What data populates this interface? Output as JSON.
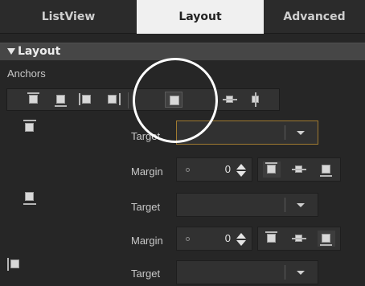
{
  "tabs": [
    {
      "label": "ListView",
      "active": false
    },
    {
      "label": "Layout",
      "active": true
    },
    {
      "label": "Advanced",
      "active": false
    }
  ],
  "section": {
    "title": "Layout",
    "expanded": true
  },
  "anchors": {
    "label": "Anchors",
    "buttons": [
      {
        "icon": "anchor-top-icon",
        "selected": false
      },
      {
        "icon": "anchor-bottom-icon",
        "selected": false
      },
      {
        "icon": "anchor-left-icon",
        "selected": false
      },
      {
        "icon": "anchor-right-icon",
        "selected": false
      },
      {
        "icon": "anchor-fill-icon",
        "selected": true
      },
      {
        "icon": "anchor-vertical-center-icon",
        "selected": false
      },
      {
        "icon": "anchor-horizontal-center-icon",
        "selected": false
      }
    ]
  },
  "rows": [
    {
      "anchor_icon": "anchor-top-icon",
      "target_label": "Target",
      "target_value": "",
      "focused": true,
      "margin_label": "Margin",
      "margin_value": "0",
      "alignment_selected": "top"
    },
    {
      "anchor_icon": "anchor-bottom-icon",
      "target_label": "Target",
      "target_value": "",
      "focused": false,
      "margin_label": "Margin",
      "margin_value": "0",
      "alignment_selected": "bottom"
    },
    {
      "anchor_icon": "anchor-left-icon",
      "target_label": "Target",
      "target_value": "",
      "focused": false
    }
  ],
  "colors": {
    "panel_bg": "#262626",
    "active_tab_bg": "#f0f0f0",
    "section_header_bg": "#464646",
    "focus_border": "#a07a30",
    "highlight_ring": "#ffffff"
  }
}
